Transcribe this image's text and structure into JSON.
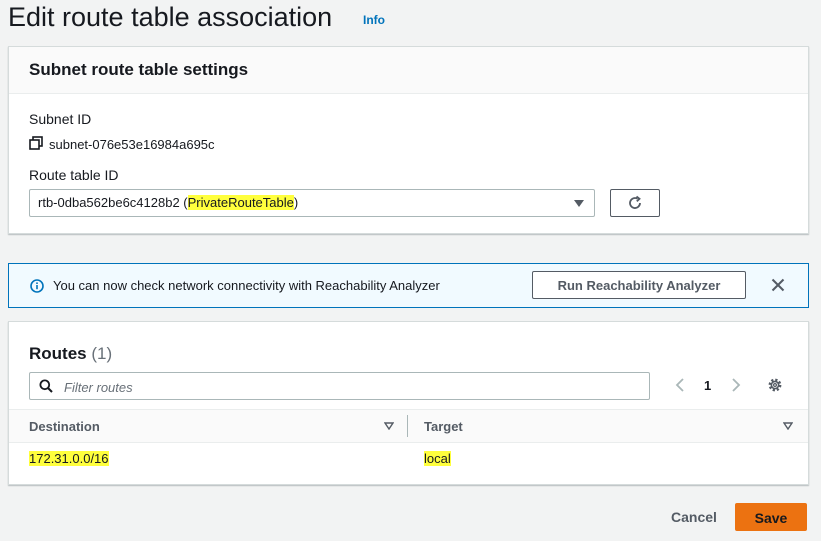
{
  "page": {
    "title": "Edit route table association",
    "info_link": "Info"
  },
  "settings_panel": {
    "title": "Subnet route table settings",
    "subnet_id_label": "Subnet ID",
    "subnet_id_value": "subnet-076e53e16984a695c",
    "route_table_label": "Route table ID",
    "route_table_id": "rtb-0dba562be6c4128b2",
    "route_table_open_paren": " (",
    "route_table_name": "PrivateRouteTable",
    "route_table_close_paren": ")"
  },
  "flash": {
    "message": "You can now check network connectivity with Reachability Analyzer",
    "button_label": "Run Reachability Analyzer"
  },
  "routes": {
    "title": "Routes",
    "count": "(1)",
    "filter_placeholder": "Filter routes",
    "page_number": "1",
    "columns": [
      "Destination",
      "Target"
    ],
    "rows": [
      {
        "destination": "172.31.0.0/16",
        "target": "local"
      }
    ]
  },
  "footer": {
    "cancel_label": "Cancel",
    "save_label": "Save"
  },
  "colors": {
    "primary_button": "#ec7211",
    "link": "#0073bb",
    "highlight": "#ffff3d",
    "info_banner_bg": "#f1faff"
  },
  "icons": [
    "copy-icon",
    "caret-down-icon",
    "refresh-icon",
    "info-icon",
    "close-icon",
    "search-icon",
    "chevron-left-icon",
    "chevron-right-icon",
    "gear-icon",
    "sort-icon"
  ]
}
